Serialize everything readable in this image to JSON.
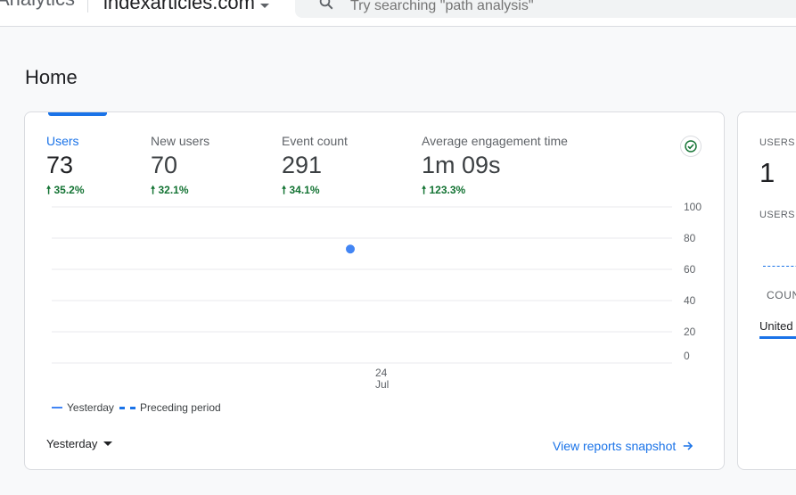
{
  "header": {
    "app_name": "Analytics",
    "property_name": "indexarticles.com",
    "search_placeholder": "Try searching \"path analysis\""
  },
  "page": {
    "title": "Home"
  },
  "overview": {
    "metrics": [
      {
        "label": "Users",
        "value": "73",
        "delta": "35.2%",
        "direction": "up",
        "active": true
      },
      {
        "label": "New users",
        "value": "70",
        "delta": "32.1%",
        "direction": "up",
        "active": false
      },
      {
        "label": "Event count",
        "value": "291",
        "delta": "34.1%",
        "direction": "up",
        "active": false
      },
      {
        "label": "Average engagement time",
        "value": "1m 09s",
        "delta": "123.3%",
        "direction": "up",
        "active": false
      }
    ],
    "status_icon": "check-circle-icon",
    "legend": {
      "current": "Yesterday",
      "previous": "Preceding period"
    },
    "date_range": "Yesterday",
    "snapshot_link": "View reports snapshot"
  },
  "chart_data": {
    "type": "scatter",
    "x_ticks": [
      {
        "day": "24",
        "month": "Jul"
      }
    ],
    "y_ticks": [
      "100",
      "80",
      "60",
      "40",
      "20",
      "0"
    ],
    "ylim": [
      0,
      100
    ],
    "grid": true,
    "series": [
      {
        "name": "Yesterday",
        "points": [
          {
            "x": "24 Jul",
            "y": 73
          }
        ]
      }
    ],
    "colors": {
      "current": "#4285f4",
      "previous": "#1a73e8"
    }
  },
  "realtime_card": {
    "label_top": "USERS",
    "value": "1",
    "label_sub": "USERS",
    "column_header": "COUN",
    "row_label": "United"
  },
  "colors": {
    "accent": "#1a73e8",
    "positive": "#137333"
  }
}
